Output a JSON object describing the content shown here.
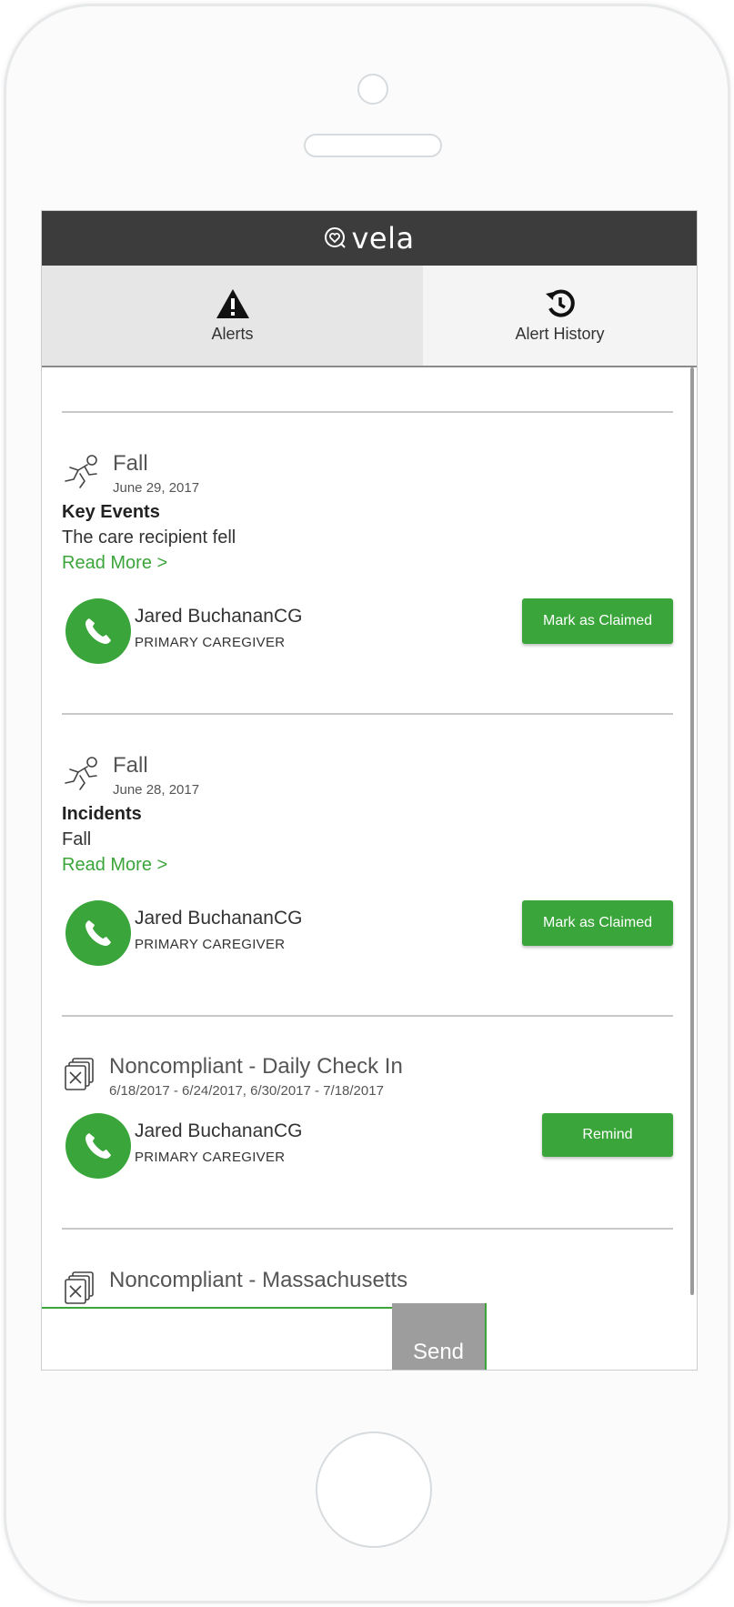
{
  "app": {
    "name": "vela"
  },
  "tabs": [
    {
      "label": "Alerts",
      "icon": "warning-icon",
      "active": true
    },
    {
      "label": "Alert History",
      "icon": "history-icon",
      "active": false
    }
  ],
  "alerts": [
    {
      "type": "Fall",
      "date": "June 29, 2017",
      "icon": "fall-icon",
      "section_title": "Key Events",
      "section_text": "The care recipient fell",
      "read_more": "Read More >",
      "contact_name": "Jared BuchananCG",
      "contact_role": "PRIMARY CAREGIVER",
      "action": "Mark as Claimed"
    },
    {
      "type": "Fall",
      "date": "June 28, 2017",
      "icon": "fall-icon",
      "section_title": "Incidents",
      "section_text": "Fall",
      "read_more": "Read More >",
      "contact_name": "Jared BuchananCG",
      "contact_role": "PRIMARY CAREGIVER",
      "action": "Mark as Claimed"
    },
    {
      "type": "Noncompliant - Daily Check In",
      "date": "6/18/2017 - 6/24/2017, 6/30/2017 - 7/18/2017",
      "icon": "noncompliant-icon",
      "contact_name": "Jared BuchananCG",
      "contact_role": "PRIMARY CAREGIVER",
      "action": "Remind"
    },
    {
      "type": "Noncompliant - Massachusetts",
      "icon": "noncompliant-icon"
    }
  ],
  "composer": {
    "send_label": "Send"
  },
  "colors": {
    "header": "#3c3c3c",
    "accent_green": "#3aa53a",
    "send_gray": "#9d9d9d"
  }
}
